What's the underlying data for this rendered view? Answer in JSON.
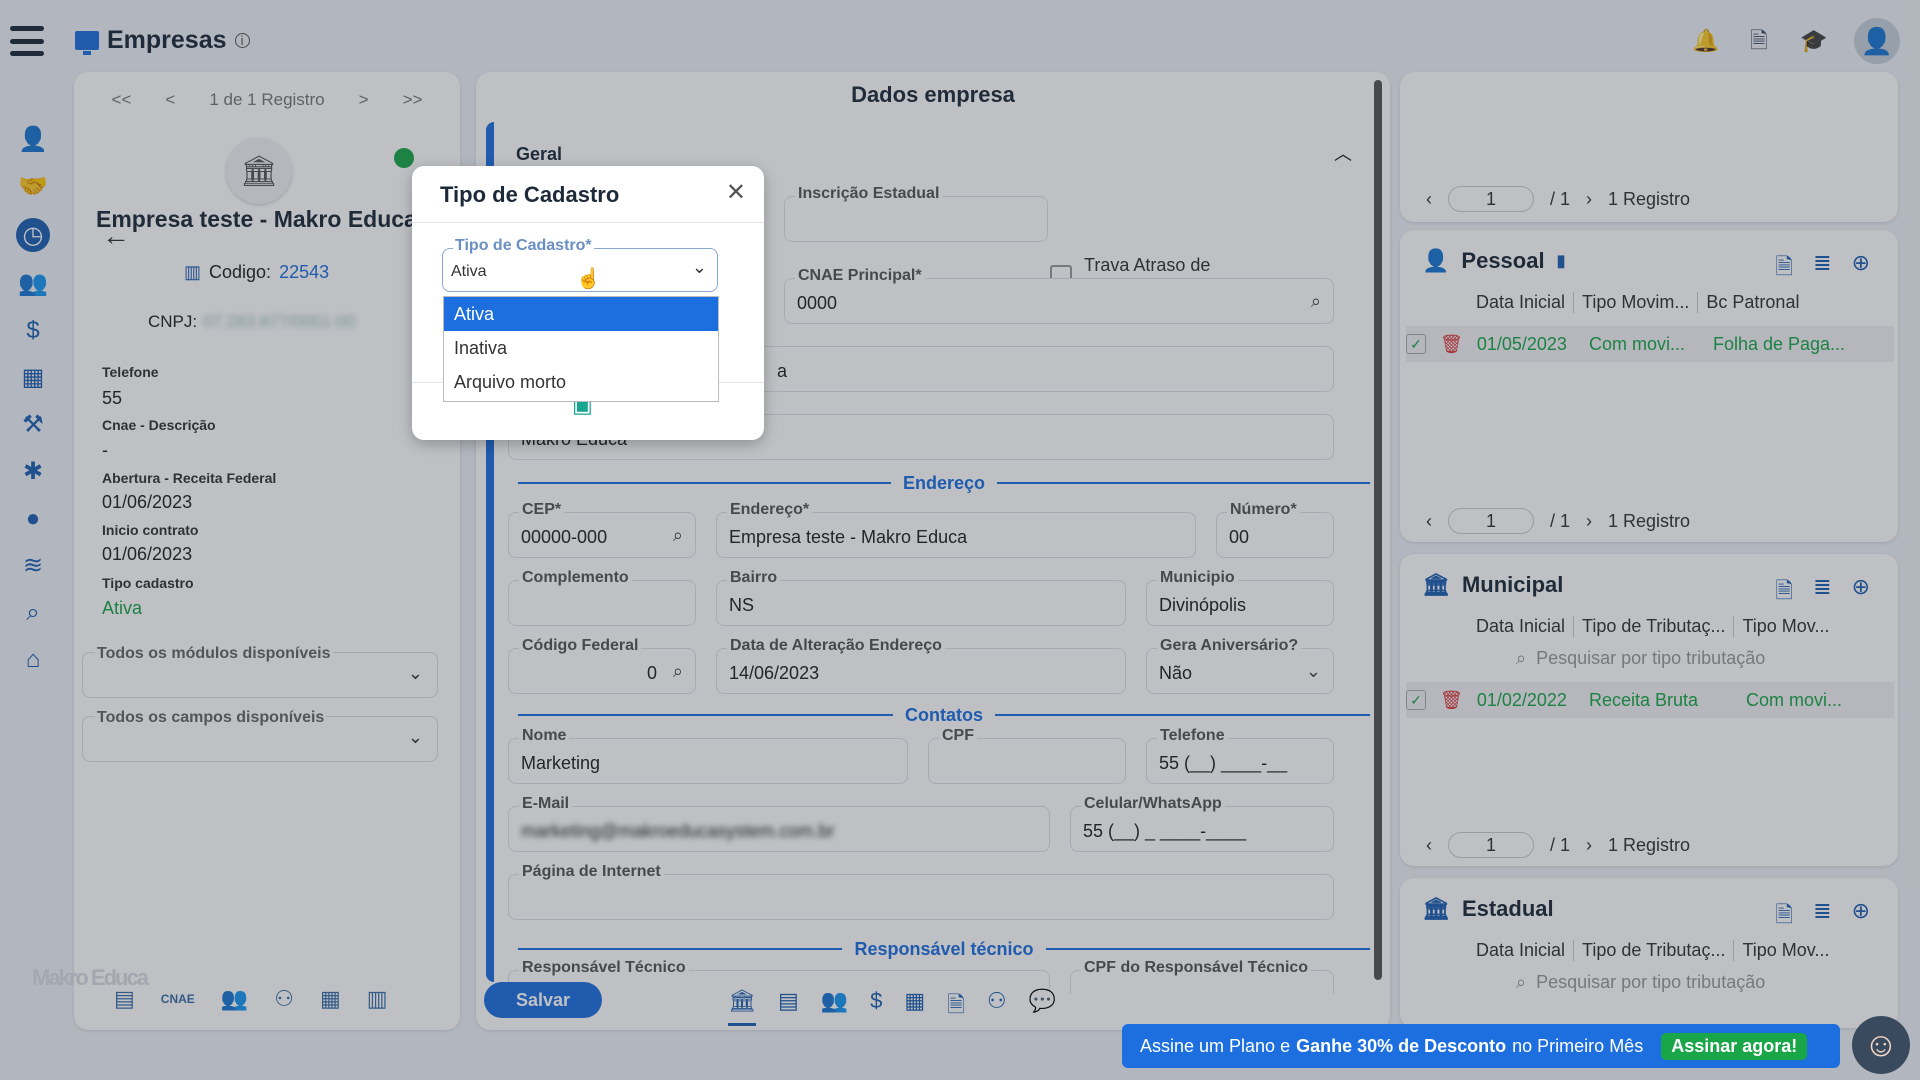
{
  "header": {
    "title": "Empresas",
    "info_icon": "i"
  },
  "left": {
    "pager": {
      "first": "<<",
      "prev": "<",
      "text": "1 de 1 Registro",
      "next": ">",
      "last": ">>"
    },
    "company_name": "Empresa teste - Makro Educa",
    "codigo_label": "Codigo:",
    "codigo_value": "22543",
    "cnpj_label": "CNPJ:",
    "cnpj_value": "07.283.877/0001-00",
    "fields": [
      {
        "label": "Telefone",
        "value": "55"
      },
      {
        "label": "Cnae - Descrição",
        "value": "-"
      },
      {
        "label": "Abertura - Receita Federal",
        "value": "01/06/2023"
      },
      {
        "label": "Inicio contrato",
        "value": "01/06/2023"
      },
      {
        "label": "Tipo cadastro",
        "value": "Ativa"
      }
    ],
    "select1": "Todos os módulos disponíveis",
    "select2": "Todos os campos disponíveis",
    "logo_text": "Makro Educa"
  },
  "mid": {
    "title": "Dados empresa",
    "section_geral": "Geral",
    "inscricao_label": "Inscrição Estadual",
    "trava_label": "Trava Atraso de Honorários",
    "cnae_label": "CNAE Principal*",
    "cnae_value": "0000",
    "partial_a": "a",
    "partial_b": "Makro Educa",
    "section_endereco": "Endereço",
    "cep_label": "CEP*",
    "cep_value": "00000-000",
    "endereco_label": "Endereço*",
    "endereco_value": "Empresa teste - Makro Educa",
    "numero_label": "Número*",
    "numero_value": "00",
    "complemento_label": "Complemento",
    "bairro_label": "Bairro",
    "bairro_value": "NS",
    "municipio_label": "Municipio",
    "municipio_value": "Divinópolis",
    "codfed_label": "Código Federal",
    "codfed_value": "0",
    "dataalt_label": "Data de Alteração Endereço",
    "dataalt_value": "14/06/2023",
    "geraniv_label": "Gera Aniversário?",
    "geraniv_value": "Não",
    "section_contatos": "Contatos",
    "nome_label": "Nome",
    "nome_value": "Marketing",
    "cpf_label": "CPF",
    "telefone_label": "Telefone",
    "telefone_value": "55 (__) ____-__",
    "email_label": "E-Mail",
    "email_value": "marketing@makroeducasystem.com.br",
    "celular_label": "Celular/WhatsApp",
    "celular_value": "55 (__) _ ____-____",
    "pagina_label": "Página de Internet",
    "section_resp": "Responsável técnico",
    "resp_label": "Responsável Técnico",
    "cpfresp_label": "CPF do Responsável Técnico",
    "save_label": "Salvar"
  },
  "right": {
    "top_pager": {
      "page": "1",
      "total": "/ 1",
      "count": "1 Registro"
    },
    "pessoal": {
      "title": "Pessoal",
      "cols": [
        "Data Inicial",
        "Tipo Movim...",
        "Bc Patronal"
      ],
      "row": [
        "01/05/2023",
        "Com movi...",
        "Folha de Paga..."
      ],
      "pager": {
        "page": "1",
        "total": "/ 1",
        "count": "1 Registro"
      }
    },
    "municipal": {
      "title": "Municipal",
      "cols": [
        "Data Inicial",
        "Tipo de Tributaç...",
        "Tipo Mov..."
      ],
      "search": "Pesquisar por tipo tributação",
      "row": [
        "01/02/2022",
        "Receita Bruta",
        "Com movi..."
      ],
      "pager": {
        "page": "1",
        "total": "/ 1",
        "count": "1 Registro"
      }
    },
    "estadual": {
      "title": "Estadual",
      "cols": [
        "Data Inicial",
        "Tipo de Tributaç...",
        "Tipo Mov..."
      ],
      "search": "Pesquisar por tipo tributação"
    }
  },
  "modal": {
    "title": "Tipo de Cadastro",
    "select_label": "Tipo de Cadastro*",
    "select_value": "Ativa",
    "options": [
      "Ativa",
      "Inativa",
      "Arquivo morto"
    ]
  },
  "promo": {
    "text_a": "Assine um Plano e",
    "text_b": "Ganhe 30% de Desconto",
    "text_c": "no Primeiro Mês",
    "cta": "Assinar agora!"
  },
  "colors": {
    "accent": "#1d6fe0",
    "success": "#19a648",
    "danger": "#d33"
  }
}
